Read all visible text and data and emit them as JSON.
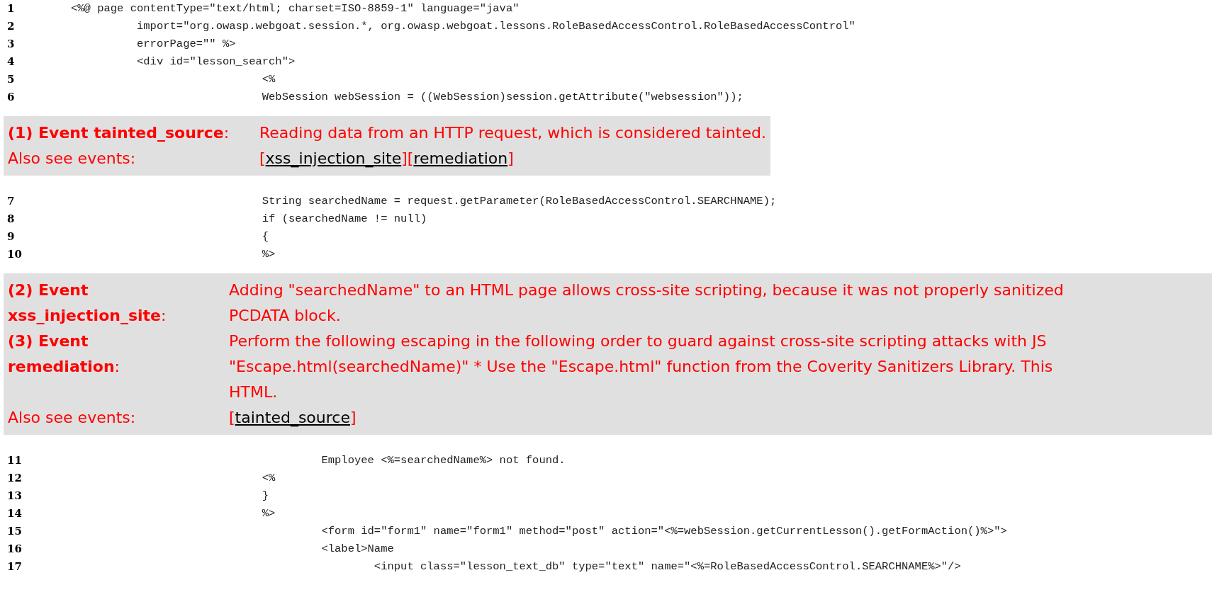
{
  "sections": [
    {
      "kind": "code",
      "lines": [
        {
          "number": "1",
          "text": "<%@ page contentType=\"text/html; charset=ISO-8859-1\" language=\"java\""
        },
        {
          "number": "2",
          "text": "          import=\"org.owasp.webgoat.session.*, org.owasp.webgoat.lessons.RoleBasedAccessControl.RoleBasedAccessControl\""
        },
        {
          "number": "3",
          "text": "          errorPage=\"\" %>"
        },
        {
          "number": "4",
          "text": "          <div id=\"lesson_search\">"
        },
        {
          "number": "5",
          "text": "                             <%"
        },
        {
          "number": "6",
          "text": "                             WebSession webSession = ((WebSession)session.getAttribute(\"websession\"));"
        }
      ]
    },
    {
      "kind": "events",
      "wide": false,
      "events": [
        {
          "label_lines": [
            "**(1) Event tainted_source**:"
          ],
          "message_lines": [
            "Reading data from an HTTP request, which is considered tainted."
          ]
        }
      ],
      "also_see": {
        "label": "Also see events:",
        "links": [
          {
            "open": "[",
            "text": "xss_injection_site",
            "close": "]"
          },
          {
            "open": "[",
            "text": "remediation",
            "close": "]"
          }
        ]
      }
    },
    {
      "kind": "code",
      "lines": [
        {
          "number": "7",
          "text": "                             String searchedName = request.getParameter(RoleBasedAccessControl.SEARCHNAME);"
        },
        {
          "number": "8",
          "text": "                             if (searchedName != null)"
        },
        {
          "number": "9",
          "text": "                             {"
        },
        {
          "number": "10",
          "text": "                             %>"
        }
      ]
    },
    {
      "kind": "events",
      "wide": true,
      "events": [
        {
          "label_lines": [
            "**(2) Event**",
            "**xss_injection_site**:"
          ],
          "message_lines": [
            "Adding \"searchedName\" to an HTML page allows cross-site scripting, because it was not properly sanitized",
            "PCDATA block."
          ]
        },
        {
          "label_lines": [
            "**(3) Event**",
            "**remediation**:"
          ],
          "message_lines": [
            "Perform the following escaping in the following order to guard against cross-site scripting attacks with JS",
            "\"Escape.html(searchedName)\" * Use the \"Escape.html\" function from the Coverity Sanitizers Library. This",
            "HTML."
          ]
        }
      ],
      "also_see": {
        "label": "Also see events:",
        "links": [
          {
            "open": "[",
            "text": "tainted_source",
            "close": "]"
          }
        ]
      }
    },
    {
      "kind": "code",
      "lines": [
        {
          "number": "11",
          "text": "                                      Employee <%=searchedName%> not found."
        },
        {
          "number": "12",
          "text": "                             <%"
        },
        {
          "number": "13",
          "text": "                             }"
        },
        {
          "number": "14",
          "text": "                             %>"
        },
        {
          "number": "15",
          "text": "                                      <form id=\"form1\" name=\"form1\" method=\"post\" action=\"<%=webSession.getCurrentLesson().getFormAction()%>\">"
        },
        {
          "number": "16",
          "text": "                                      <label>Name"
        },
        {
          "number": "17",
          "text": "                                              <input class=\"lesson_text_db\" type=\"text\" name=\"<%=RoleBasedAccessControl.SEARCHNAME%>\"/>"
        }
      ]
    }
  ]
}
